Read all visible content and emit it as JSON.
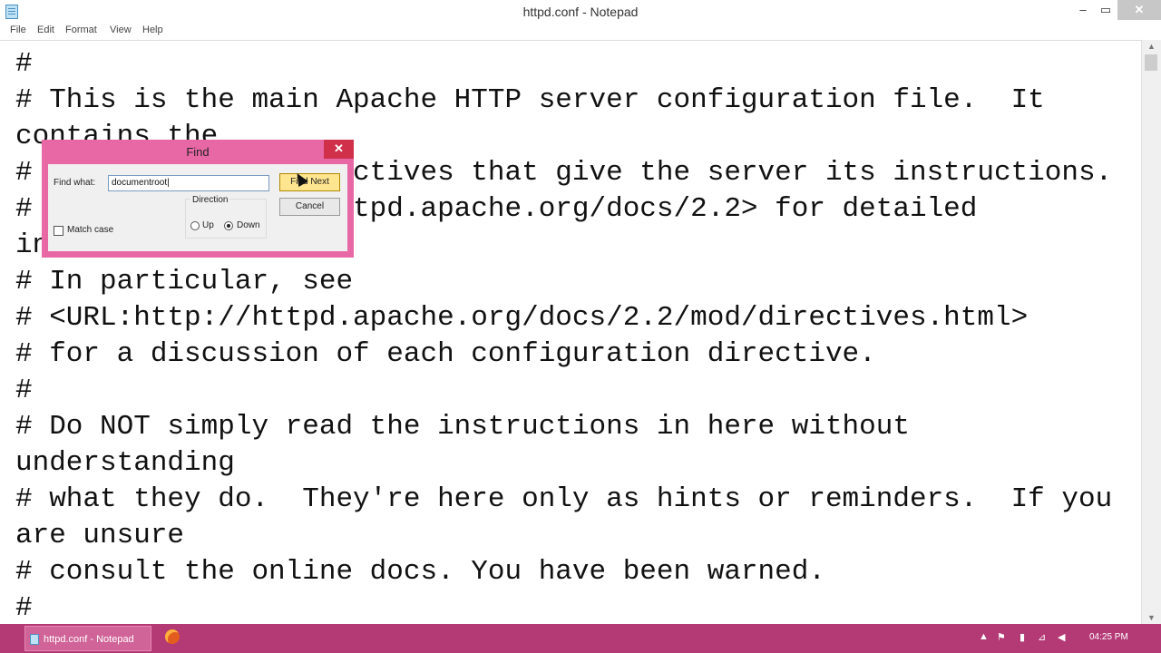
{
  "window": {
    "title": "httpd.conf - Notepad",
    "min_symbol": "–",
    "max_symbol": "▭",
    "close_symbol": "✕"
  },
  "menu": {
    "items": [
      "File",
      "Edit",
      "Format",
      "View",
      "Help"
    ]
  },
  "editor": {
    "lines": [
      "#",
      "# This is the main Apache HTTP server configuration file.  It",
      "contains the",
      "# configuration directives that give the server its instructions.",
      "# See <URL:http://httpd.apache.org/docs/2.2> for detailed",
      "information.",
      "# In particular, see",
      "# <URL:http://httpd.apache.org/docs/2.2/mod/directives.html>",
      "# for a discussion of each configuration directive.",
      "#",
      "# Do NOT simply read the instructions in here without",
      "understanding",
      "# what they do.  They're here only as hints or reminders.  If you",
      "are unsure",
      "# consult the online docs. You have been warned.",
      "#"
    ]
  },
  "find_dialog": {
    "title": "Find",
    "close_symbol": "✕",
    "find_what_label": "Find what:",
    "find_what_value": "documentroot",
    "find_next_label": "Find Next",
    "cancel_label": "Cancel",
    "direction_label": "Direction",
    "up_label": "Up",
    "down_label": "Down",
    "direction_selected": "Down",
    "match_case_label": "Match case",
    "match_case_checked": false
  },
  "taskbar": {
    "notepad_label": "httpd.conf - Notepad",
    "clock": "04:25 PM"
  }
}
